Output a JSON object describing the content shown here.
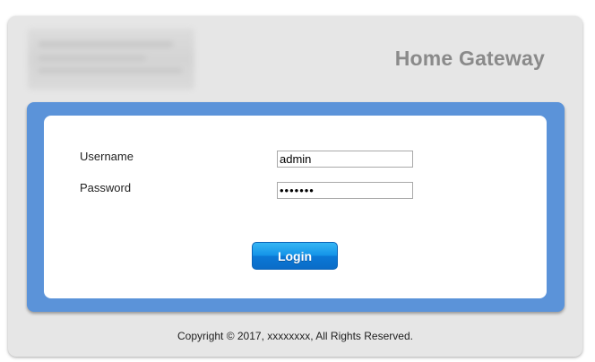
{
  "header": {
    "title": "Home Gateway"
  },
  "login_form": {
    "username_label": "Username",
    "username_value": "admin",
    "password_label": "Password",
    "password_value": "•••••••",
    "login_button_label": "Login"
  },
  "footer": {
    "copyright": "Copyright © 2017, xxxxxxxx, All Rights Reserved."
  },
  "colors": {
    "panel_background": "#e6e6e6",
    "frame_blue": "#5b93d9",
    "button_blue": "#1494e8",
    "title_gray": "#8a8a8a"
  }
}
